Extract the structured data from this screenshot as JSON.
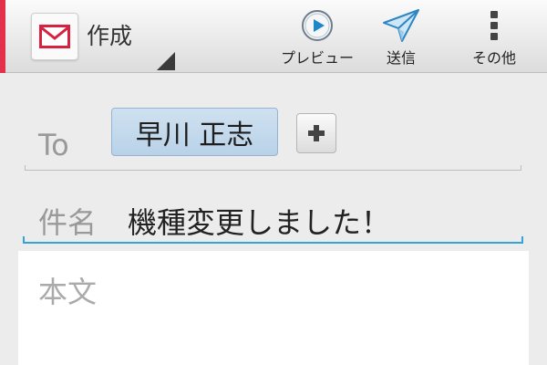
{
  "actionbar": {
    "title": "作成",
    "app_icon": "mail-envelope-icon",
    "accent_color": "#e2304d",
    "actions": [
      {
        "label": "プレビュー",
        "icon": "play-circle-icon"
      },
      {
        "label": "送信",
        "icon": "paper-plane-icon"
      },
      {
        "label": "その他",
        "icon": "overflow-menu-icon"
      }
    ]
  },
  "compose": {
    "to_label": "To",
    "recipients": [
      "早川 正志"
    ],
    "add_recipient_icon": "plus-icon",
    "subject_label": "件名",
    "subject_value": "機種変更しました！",
    "body_placeholder": "本文",
    "focus_color": "#33a3d9"
  }
}
